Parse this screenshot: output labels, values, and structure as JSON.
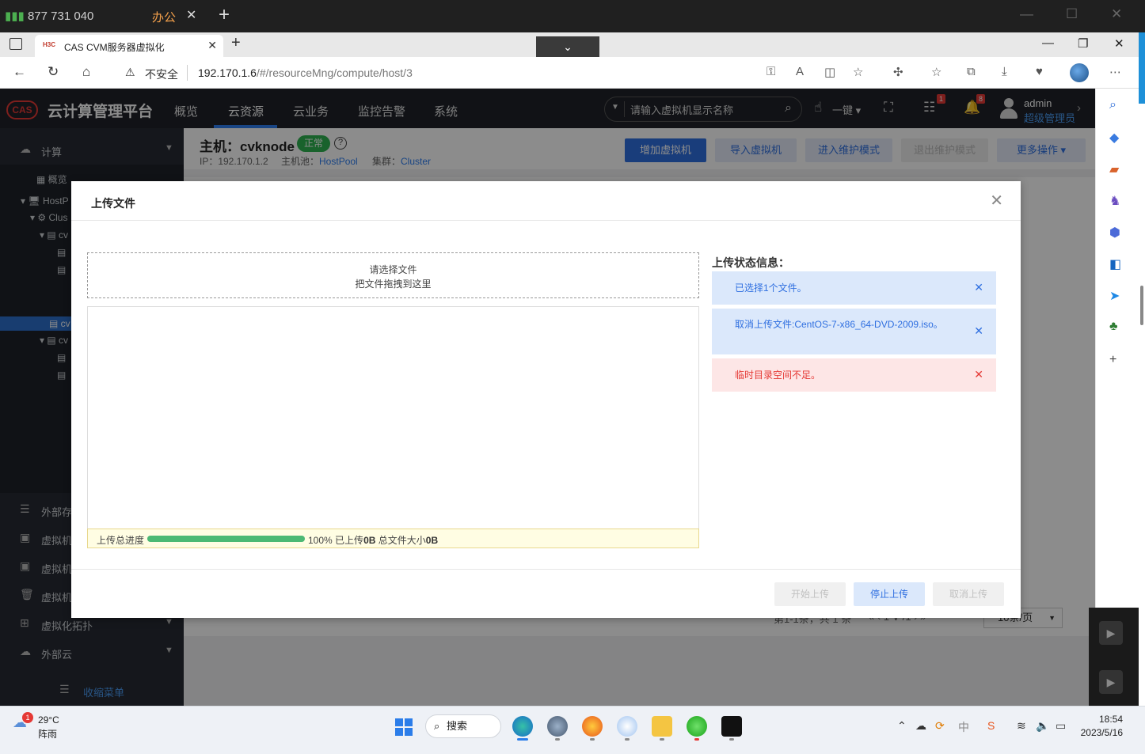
{
  "remote": {
    "connection_id": "877 731 040",
    "session_tab": "办公",
    "close": "✕",
    "plus": "+"
  },
  "browser": {
    "tab_title": "CAS CVM服务器虚拟化",
    "favicon_text": "H3C",
    "address_warning": "不安全",
    "url_host": "192.170.1.6",
    "url_path": "/#/resourceMng/compute/host/3"
  },
  "app": {
    "name": "云计算管理平台",
    "logo_text": "CAS",
    "menu": [
      "概览",
      "云资源",
      "云业务",
      "监控告警",
      "系统"
    ],
    "search_placeholder": "请输入虚拟机显示名称",
    "one_click": "一键",
    "task_badge": "1",
    "alarm_badge": "8",
    "user_name": "admin",
    "user_role": "超级管理员",
    "colors": {
      "accent": "#2f7ef0",
      "header_bg": "#1f2228",
      "nav_bg": "#272b33",
      "ok": "#2fb350",
      "error": "#e53935"
    }
  },
  "leftnav": {
    "compute": "计算",
    "overview": "概览",
    "tree": [
      "HostP",
      "Clus",
      "cv",
      "cv",
      "cv"
    ],
    "storage": "外部存",
    "vm1": "虚拟机",
    "vm2": "虚拟机",
    "vm3": "虚拟机",
    "topology": "虚拟化拓扑",
    "external_cloud": "外部云",
    "collapse": "收缩菜单"
  },
  "host": {
    "title": "主机：cvknode",
    "status": "正常",
    "ip_label": "IP：192.170.1.2",
    "pool_label": "主机池：",
    "pool": "HostPool",
    "cluster_label": "集群：",
    "cluster": "Cluster",
    "actions": {
      "add_vm": "增加虚拟机",
      "import_vm": "导入虚拟机",
      "enter_maintenance": "进入维护模式",
      "exit_maintenance": "退出维护模式",
      "more": "更多操作"
    },
    "pager_text": "第1-1条，共 1 条",
    "pager_nav": "« ‹  1 ∨ /1  › »",
    "page_size": "10条/页"
  },
  "modal": {
    "title": "上传文件",
    "dropzone_line1": "请选择文件",
    "dropzone_line2": "把文件拖拽到这里",
    "progress_label": "上传总进度",
    "progress_percent": 100,
    "progress_text_pct": "100%",
    "uploaded_label": "已上传",
    "uploaded_value": "0B",
    "total_label": "总文件大小",
    "total_value": "0B",
    "status_title": "上传状态信息：",
    "messages": [
      {
        "text": "已选择1个文件。",
        "kind": "info"
      },
      {
        "text": "取消上传文件:CentOS-7-x86_64-DVD-2009.iso。",
        "kind": "info"
      },
      {
        "text": "临时目录空间不足。",
        "kind": "error"
      }
    ],
    "btn_start": "开始上传",
    "btn_stop": "停止上传",
    "btn_cancel": "取消上传"
  },
  "taskbar": {
    "weather_badge": "1",
    "temp": "29°C",
    "condition": "阵雨",
    "search": "搜索",
    "time": "18:54",
    "date": "2023/5/16"
  }
}
